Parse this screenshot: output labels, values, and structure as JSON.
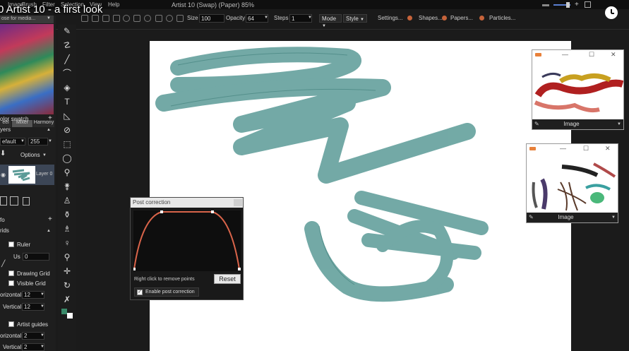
{
  "video_title": "0 Artist 10 - a first look",
  "menu": [
    "Image",
    "Brush",
    "Filter",
    "Selection",
    "View",
    "Help"
  ],
  "doc_title": "Artist 10  (Swap)  (Paper)  85%",
  "toolbar": {
    "size_label": "Size",
    "size_value": "100",
    "opacity_label": "Opacity",
    "opacity_value": "64",
    "steps_label": "Steps",
    "steps_value": "1",
    "mode_label": "Mode",
    "style_label": "Style",
    "settings_label": "Settings...",
    "shapes_label": "Shapes...",
    "papers_label": "Papers...",
    "particles_label": "Particles..."
  },
  "left_panel": {
    "palette_select": "ose for media...",
    "palette_tabs": [
      "eel",
      "Mixer",
      "Harmony"
    ],
    "color_swatch_label": "olor swatch",
    "layers_label": "yers",
    "blend_mode": "efault",
    "layer_opacity": "255",
    "options_label": "Options",
    "layer_name": "Layer 0",
    "info_label": "fo",
    "grids_label": "rids",
    "ruler_label": "Ruler",
    "us_label": "Us",
    "us_value": "0",
    "drawing_grid_label": "Drawing Grid",
    "visible_grid_label": "Visible Grid",
    "horizontal_label": "orizontal",
    "horizontal_value": "12",
    "vertical_label": "Vertical",
    "vertical_value": "12",
    "artist_guides_label": "Artist guides",
    "guide_horizontal_label": "orizontal",
    "guide_horizontal_value": "2",
    "guide_vertical_label": "Vertical",
    "guide_vertical_value": "2"
  },
  "post_correction": {
    "title": "Post correction",
    "hint": "Right click to remove points",
    "reset_label": "Reset",
    "enable_label": "Enable post correction",
    "enabled": true
  },
  "image_windows": [
    {
      "label": "Image"
    },
    {
      "label": "Image"
    }
  ],
  "colors": {
    "stroke": "#5b9b97",
    "curve": "#d9644a",
    "accent": "#c6633a"
  }
}
